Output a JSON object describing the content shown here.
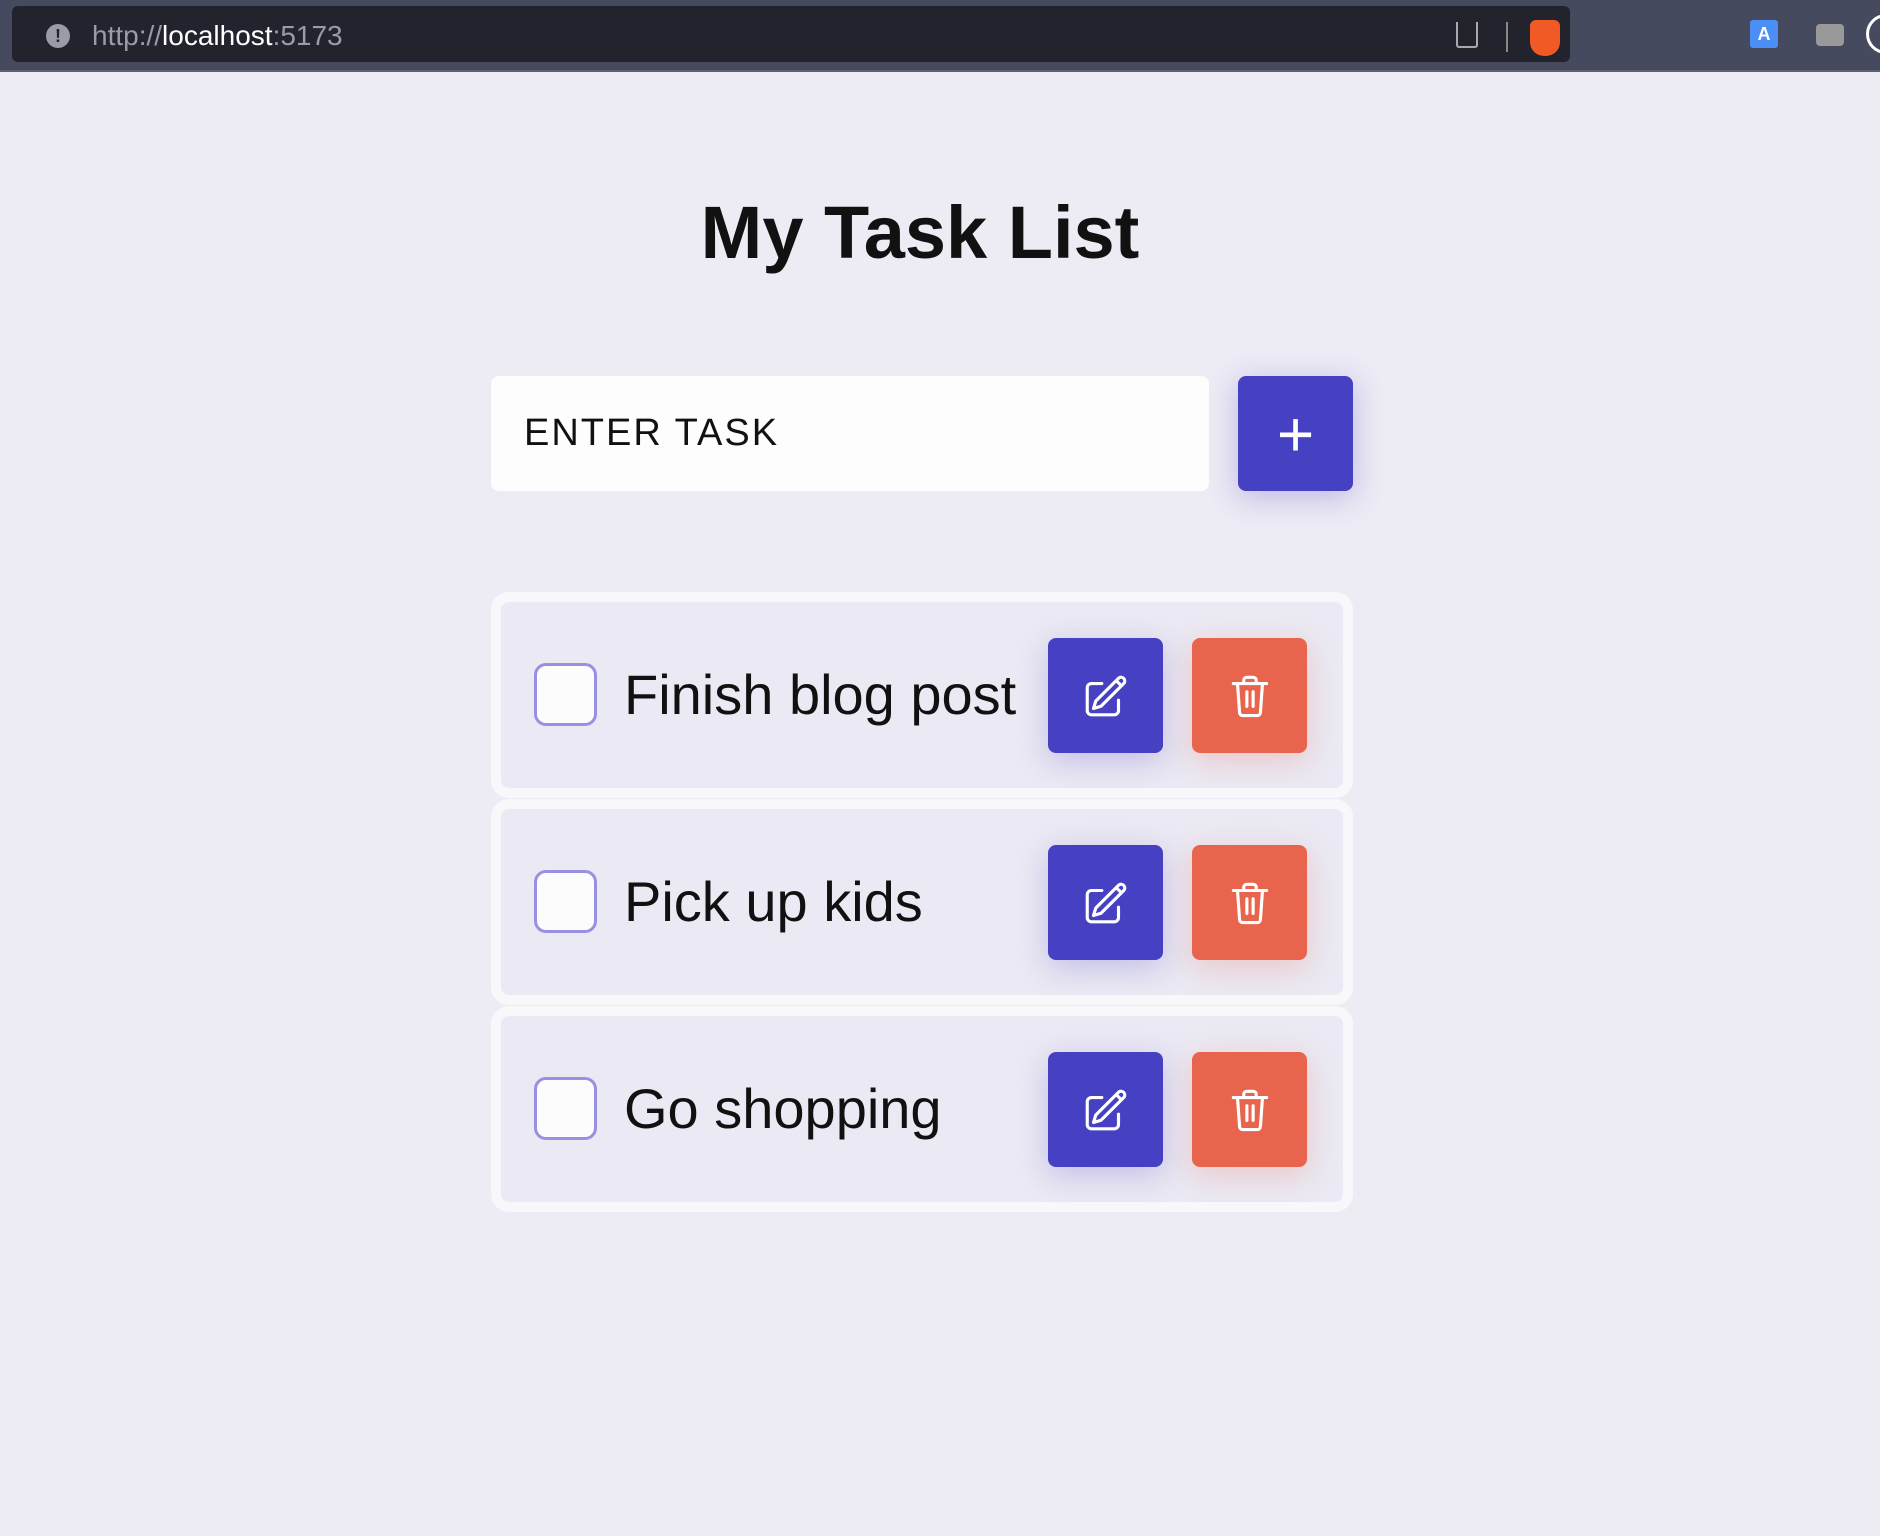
{
  "browser": {
    "url_scheme": "http://",
    "url_host": "localhost",
    "url_port": ":5173",
    "translate_label": "A"
  },
  "page": {
    "title": "My Task List"
  },
  "new_task": {
    "placeholder": "ENTER TASK",
    "add_icon": "+"
  },
  "tasks": [
    {
      "text": "Finish blog post",
      "done": false
    },
    {
      "text": "Pick up kids",
      "done": false
    },
    {
      "text": "Go shopping",
      "done": false
    }
  ],
  "colors": {
    "primary": "#4640c2",
    "danger": "#e9644c",
    "background": "#edebf4"
  }
}
